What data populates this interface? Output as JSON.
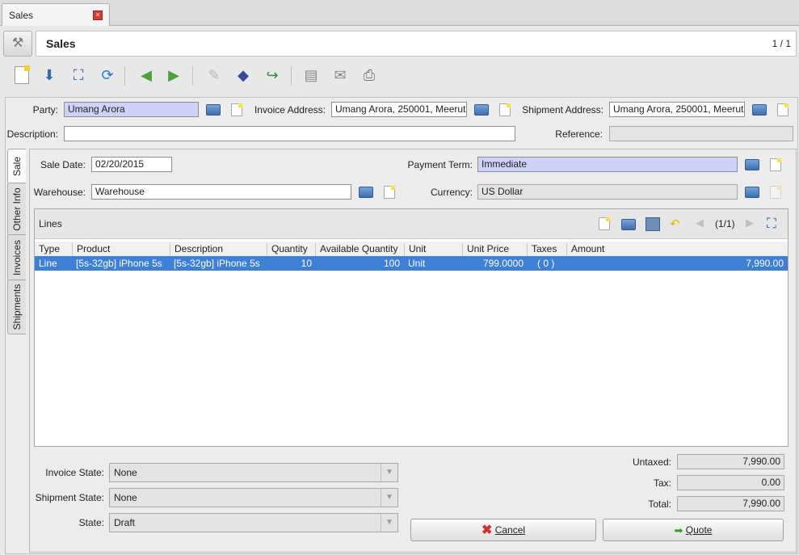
{
  "tab": {
    "title": "Sales",
    "close": "×"
  },
  "header": {
    "title": "Sales",
    "count": "1 / 1"
  },
  "form": {
    "party_label": "Party:",
    "party": "Umang Arora",
    "invoice_address_label": "Invoice Address:",
    "invoice_address": "Umang Arora, 250001, Meerut",
    "shipment_address_label": "Shipment Address:",
    "shipment_address": "Umang Arora, 250001, Meerut",
    "description_label": "Description:",
    "description": "",
    "reference_label": "Reference:",
    "reference": ""
  },
  "side_tabs": [
    "Sale",
    "Other Info",
    "Invoices",
    "Shipments"
  ],
  "sale": {
    "sale_date_label": "Sale Date:",
    "sale_date": "02/20/2015",
    "payment_term_label": "Payment Term:",
    "payment_term": "Immediate",
    "warehouse_label": "Warehouse:",
    "warehouse": "Warehouse",
    "currency_label": "Currency:",
    "currency": "US Dollar"
  },
  "lines": {
    "title": "Lines",
    "pager": "(1/1)",
    "columns": [
      "Type",
      "Product",
      "Description",
      "Quantity",
      "Available Quantity",
      "Unit",
      "Unit Price",
      "Taxes",
      "Amount"
    ],
    "rows": [
      {
        "type": "Line",
        "product": "[5s-32gb] iPhone 5s",
        "description": "[5s-32gb] iPhone 5s",
        "quantity": "10",
        "available": "100",
        "unit": "Unit",
        "unit_price": "799.0000",
        "taxes": "( 0 )",
        "amount": "7,990.00"
      }
    ]
  },
  "states": {
    "invoice_state_label": "Invoice State:",
    "invoice_state": "None",
    "shipment_state_label": "Shipment State:",
    "shipment_state": "None",
    "state_label": "State:",
    "state": "Draft"
  },
  "totals": {
    "untaxed_label": "Untaxed:",
    "untaxed": "7,990.00",
    "tax_label": "Tax:",
    "tax": "0.00",
    "total_label": "Total:",
    "total": "7,990.00"
  },
  "buttons": {
    "cancel": "Cancel",
    "quote": "Quote"
  }
}
